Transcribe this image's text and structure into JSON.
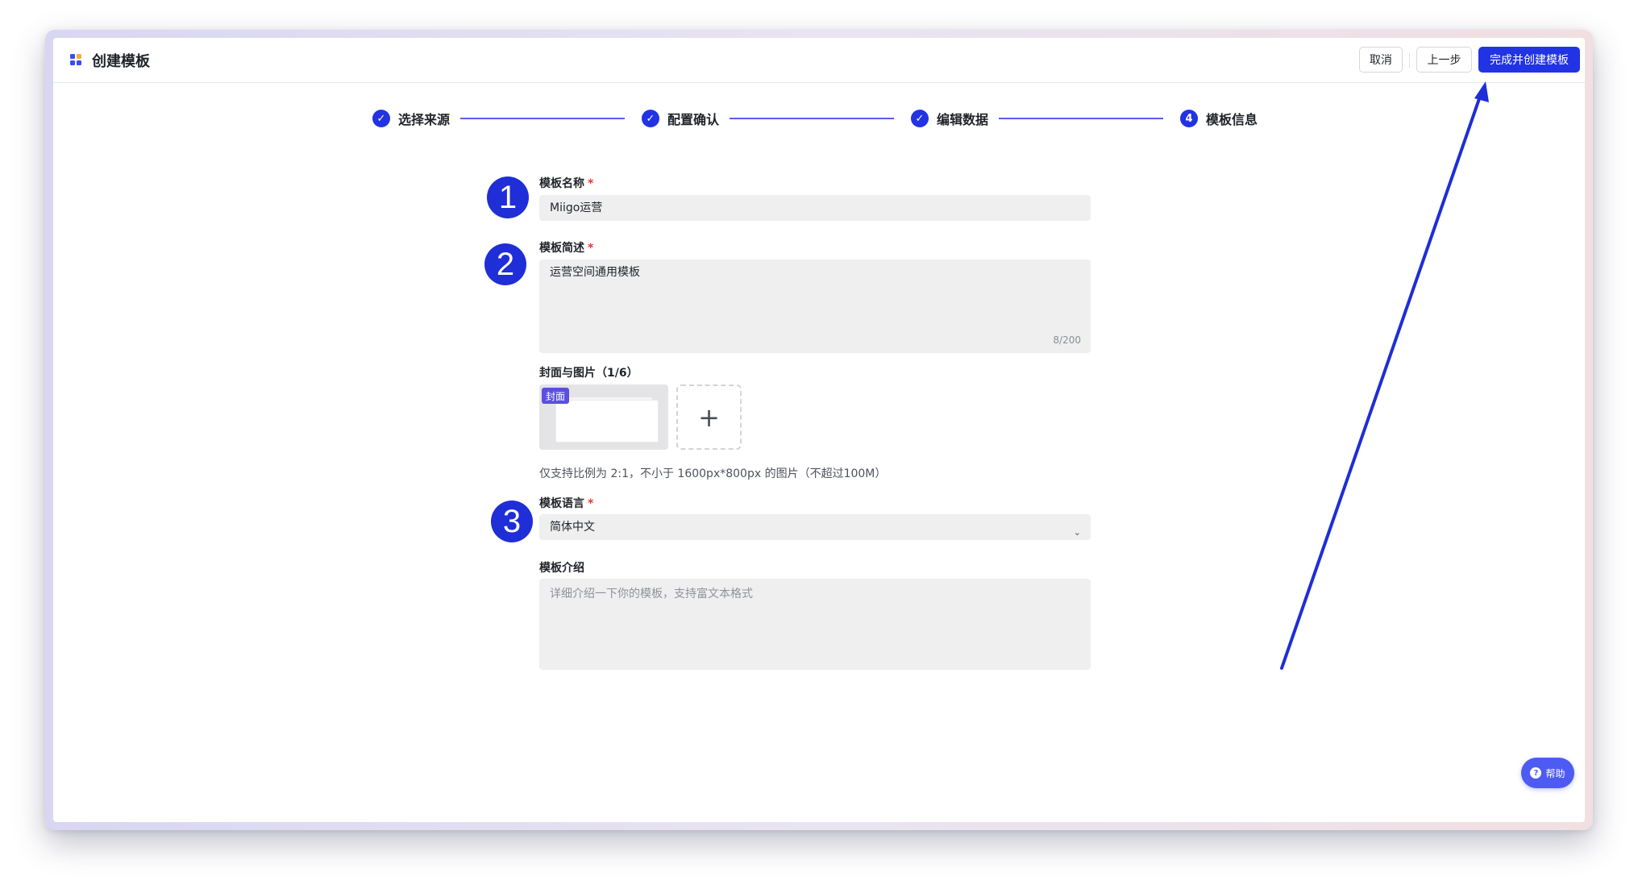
{
  "app": {
    "title": "创建模板"
  },
  "header": {
    "cancel_label": "取消",
    "prev_label": "上一步",
    "finish_label": "完成并创建模板"
  },
  "steps": [
    {
      "label": "选择来源",
      "state": "done"
    },
    {
      "label": "配置确认",
      "state": "done"
    },
    {
      "label": "编辑数据",
      "state": "done"
    },
    {
      "label": "模板信息",
      "state": "active",
      "number": "4"
    }
  ],
  "form": {
    "name": {
      "label": "模板名称",
      "required": "*",
      "value": "Miigo运营"
    },
    "description": {
      "label": "模板简述",
      "required": "*",
      "value": "运营空间通用模板",
      "counter": "8/200"
    },
    "cover": {
      "label": "封面与图片（1/6）",
      "tag": "封面",
      "add_symbol": "+",
      "hint": "仅支持比例为 2:1，不小于 1600px*800px 的图片（不超过100M）"
    },
    "language": {
      "label": "模板语言",
      "required": "*",
      "value": "简体中文"
    },
    "intro": {
      "label": "模板介绍",
      "placeholder": "详细介绍一下你的模板，支持富文本格式"
    }
  },
  "annotations": {
    "marker_1": "1",
    "marker_2": "2",
    "marker_3": "3"
  },
  "help": {
    "label": "帮助",
    "icon_symbol": "?"
  },
  "colors": {
    "primary": "#2233e3",
    "annotation": "#1f2ed6",
    "help": "#4d5bf2"
  }
}
